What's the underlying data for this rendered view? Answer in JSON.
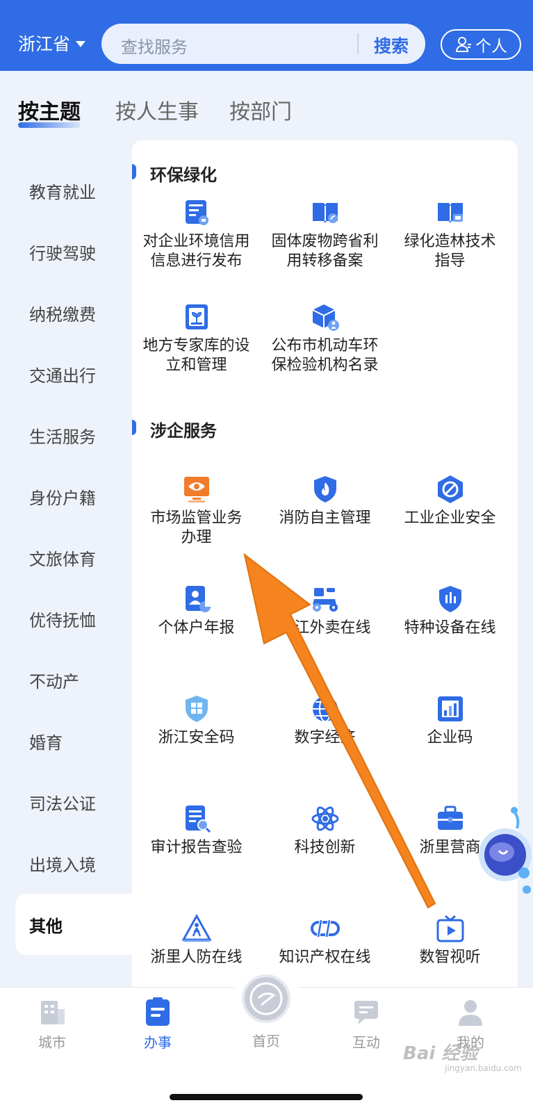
{
  "header": {
    "province": "浙江省",
    "search_placeholder": "查找服务",
    "search_button": "搜索",
    "personal_label": "个人",
    "bg_color": "#2f6ce5"
  },
  "category_tabs": [
    {
      "label": "按主题",
      "active": true
    },
    {
      "label": "按人生事",
      "active": false
    },
    {
      "label": "按部门",
      "active": false
    }
  ],
  "sidebar": {
    "items": [
      {
        "label": "教育就业"
      },
      {
        "label": "行驶驾驶"
      },
      {
        "label": "纳税缴费"
      },
      {
        "label": "交通出行"
      },
      {
        "label": "生活服务"
      },
      {
        "label": "身份户籍"
      },
      {
        "label": "文旅体育"
      },
      {
        "label": "优待抚恤"
      },
      {
        "label": "不动产"
      },
      {
        "label": "婚育"
      },
      {
        "label": "司法公证"
      },
      {
        "label": "出境入境"
      },
      {
        "label": "其他",
        "active": true
      }
    ]
  },
  "sections": [
    {
      "title": "环保绿化",
      "services": [
        {
          "label_lines": [
            "对企业环境信用",
            "信息进行发布"
          ],
          "icon": "document-report-icon"
        },
        {
          "label_lines": [
            "固体废物跨省利",
            "用转移备案"
          ],
          "icon": "book-leaf-icon"
        },
        {
          "label_lines": [
            "绿化造林技术",
            "指导"
          ],
          "icon": "book-screen-icon"
        },
        {
          "label_lines": [
            "地方专家库的设",
            "立和管理"
          ],
          "icon": "plant-frame-icon"
        },
        {
          "label_lines": [
            "公布市机动车环",
            "保检验机构名录"
          ],
          "icon": "cube-person-icon"
        }
      ]
    },
    {
      "title": "涉企服务",
      "services": [
        {
          "label_lines": [
            "市场监管业务",
            "办理"
          ],
          "icon": "monitor-eye-icon",
          "accent": "#f07c2c"
        },
        {
          "label_lines": [
            "消防自主管理"
          ],
          "icon": "fire-shield-icon"
        },
        {
          "label_lines": [
            "工业企业安全"
          ],
          "icon": "hexagon-slash-icon"
        },
        {
          "label_lines": [
            "个体户年报"
          ],
          "icon": "id-card-chart-icon"
        },
        {
          "label_lines": [
            "浙江外卖在线"
          ],
          "icon": "scooter-icon"
        },
        {
          "label_lines": [
            "特种设备在线"
          ],
          "icon": "shield-bars-icon"
        },
        {
          "label_lines": [
            "浙江安全码"
          ],
          "icon": "shield-qr-icon"
        },
        {
          "label_lines": [
            "数字经济"
          ],
          "icon": "globe-icon"
        },
        {
          "label_lines": [
            "企业码"
          ],
          "icon": "chart-frame-icon"
        },
        {
          "label_lines": [
            "审计报告查验"
          ],
          "icon": "report-search-icon"
        },
        {
          "label_lines": [
            "科技创新"
          ],
          "icon": "atom-icon"
        },
        {
          "label_lines": [
            "浙里营商"
          ],
          "icon": "briefcase-icon"
        },
        {
          "label_lines": [
            "浙里人防在线"
          ],
          "icon": "warning-person-icon"
        },
        {
          "label_lines": [
            "知识产权在线"
          ],
          "icon": "ip-logo-icon"
        },
        {
          "label_lines": [
            "数智视听"
          ],
          "icon": "tv-play-icon"
        }
      ]
    }
  ],
  "bottom_nav": [
    {
      "label": "城市",
      "icon": "building-icon",
      "active": false
    },
    {
      "label": "办事",
      "icon": "clipboard-icon",
      "active": true
    },
    {
      "label": "首页",
      "icon": "home-logo-icon",
      "active": false
    },
    {
      "label": "互动",
      "icon": "chat-icon",
      "active": false
    },
    {
      "label": "我的",
      "icon": "user-icon",
      "active": false
    }
  ],
  "watermark": {
    "text": "Bai 经验",
    "sub": "jingyan.baidu.com"
  },
  "colors": {
    "accent": "#2f6ce5",
    "arrow": "#f5841f"
  }
}
